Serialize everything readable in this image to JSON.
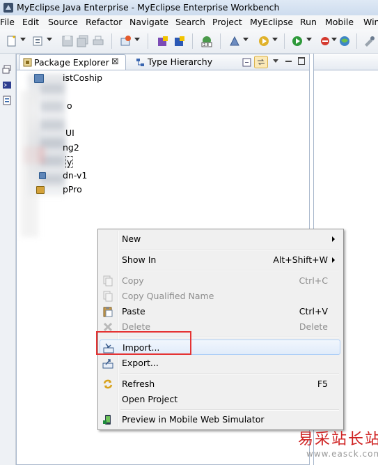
{
  "window": {
    "title": "MyEclipse Java Enterprise - MyEclipse Enterprise Workbench"
  },
  "menubar": {
    "items": [
      "File",
      "Edit",
      "Source",
      "Refactor",
      "Navigate",
      "Search",
      "Project",
      "MyEclipse",
      "Run",
      "Mobile",
      "Win"
    ]
  },
  "views": {
    "tabs": [
      {
        "label": "Package Explorer",
        "icon": "package-explorer-icon",
        "close": "⊠"
      },
      {
        "label": "Type Hierarchy",
        "icon": "type-hierarchy-icon"
      }
    ]
  },
  "tree": {
    "items": [
      "istCoship",
      "o",
      "UI",
      "ng2",
      "y",
      "dn-v1",
      "pPro"
    ]
  },
  "context_menu": {
    "items": [
      {
        "label": "New",
        "submenu": true
      },
      {
        "label": "Show In",
        "accelerator": "Alt+Shift+W",
        "submenu": true
      },
      {
        "label": "Copy",
        "accelerator": "Ctrl+C",
        "disabled": true,
        "icon": "copy-icon"
      },
      {
        "label": "Copy Qualified Name",
        "disabled": true,
        "icon": "copy-qualified-name-icon"
      },
      {
        "label": "Paste",
        "accelerator": "Ctrl+V",
        "icon": "paste-icon"
      },
      {
        "label": "Delete",
        "accelerator": "Delete",
        "disabled": true,
        "icon": "delete-icon"
      },
      {
        "label": "Import...",
        "icon": "import-icon",
        "highlighted": true
      },
      {
        "label": "Export...",
        "icon": "export-icon"
      },
      {
        "label": "Refresh",
        "accelerator": "F5",
        "icon": "refresh-icon"
      },
      {
        "label": "Open Project"
      },
      {
        "label": "Preview in Mobile Web Simulator",
        "icon": "mobile-simulator-icon"
      }
    ]
  },
  "annotation": {
    "color": "#e53333"
  },
  "watermark": {
    "text": "易采站长站",
    "url": "www.easck.com"
  }
}
